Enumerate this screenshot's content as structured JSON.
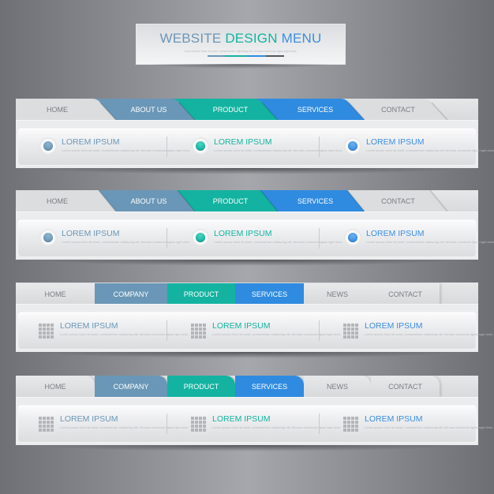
{
  "colors": {
    "steel_blue": "#6a97b7",
    "teal": "#14b3a1",
    "blue": "#2f8be0",
    "light_tab": "#dcdddf",
    "tab_text_light": "#7a7c80",
    "desc_text": "#b8babd"
  },
  "header": {
    "title_parts": [
      {
        "text": "WEBSITE ",
        "color": "#6a97b7"
      },
      {
        "text": "DESIGN ",
        "color": "#14b3a1"
      },
      {
        "text": "MENU",
        "color": "#3b8ee0"
      }
    ],
    "subtitle": "Lorem ipsum dolor sit amet, consectetuer adipiscing elit. Aenean commodo ligula eget dolor.",
    "underline_segments": [
      "#6a97b7",
      "#14b3a1",
      "#2f8be0",
      "#55575b"
    ]
  },
  "menus": [
    {
      "style": "curved-slant",
      "tabs": [
        "HOME",
        "ABOUT US",
        "PRODUCT",
        "SERVICES",
        "CONTACT"
      ],
      "icon": "circle-button-icon",
      "columns": [
        {
          "heading": "LOREM IPSUM",
          "color": "#6a97b7",
          "desc": "Lorem ipsum dolor sit amet, consectetuer adipiscing elit. Aenean commodo ligula eget dolor."
        },
        {
          "heading": "LOREM IPSUM",
          "color": "#14b3a1",
          "desc": "Lorem ipsum dolor sit amet, consectetuer adipiscing elit. Aenean commodo ligula eget dolor."
        },
        {
          "heading": "LOREM IPSUM",
          "color": "#3b8ee0",
          "desc": "Lorem ipsum dolor sit amet, consectetuer adipiscing elit. Aenean commodo ligula eget dolor."
        }
      ]
    },
    {
      "style": "straight-slant",
      "tabs": [
        "HOME",
        "ABOUT US",
        "PRODUCT",
        "SERVICES",
        "CONTACT"
      ],
      "icon": "circle-button-icon",
      "columns": [
        {
          "heading": "LOREM IPSUM",
          "color": "#6a97b7",
          "desc": "Lorem ipsum dolor sit amet, consectetuer adipiscing elit. Aenean commodo ligula eget dolor."
        },
        {
          "heading": "LOREM IPSUM",
          "color": "#14b3a1",
          "desc": "Lorem ipsum dolor sit amet, consectetuer adipiscing elit. Aenean commodo ligula eget dolor."
        },
        {
          "heading": "LOREM IPSUM",
          "color": "#3b8ee0",
          "desc": "Lorem ipsum dolor sit amet, consectetuer adipiscing elit. Aenean commodo ligula eget dolor."
        }
      ]
    },
    {
      "style": "rectangular",
      "tabs": [
        "HOME",
        "COMPANY",
        "PRODUCT",
        "SERVICES",
        "NEWS",
        "CONTACT"
      ],
      "icon": "grid-icon",
      "columns": [
        {
          "heading": "LOREM IPSUM",
          "color": "#6a97b7",
          "desc": "Lorem ipsum dolor sit amet, consectetuer adipiscing elit. Aenean commodo ligula eget dolor."
        },
        {
          "heading": "LOREM IPSUM",
          "color": "#14b3a1",
          "desc": "Lorem ipsum dolor sit amet, consectetuer adipiscing elit. Aenean commodo ligula eget dolor."
        },
        {
          "heading": "LOREM IPSUM",
          "color": "#3b8ee0",
          "desc": "Lorem ipsum dolor sit amet, consectetuer adipiscing elit. Aenean commodo ligula eget dolor."
        }
      ]
    },
    {
      "style": "rounded",
      "tabs": [
        "HOME",
        "COMPANY",
        "PRODUCT",
        "SERVICES",
        "NEWS",
        "CONTACT"
      ],
      "icon": "grid-icon",
      "columns": [
        {
          "heading": "LOREM IPSUM",
          "color": "#6a97b7",
          "desc": "Lorem ipsum dolor sit amet, consectetuer adipiscing elit. Aenean commodo ligula eget dolor."
        },
        {
          "heading": "LOREM IPSUM",
          "color": "#14b3a1",
          "desc": "Lorem ipsum dolor sit amet, consectetuer adipiscing elit. Aenean commodo ligula eget dolor."
        },
        {
          "heading": "LOREM IPSUM",
          "color": "#3b8ee0",
          "desc": "Lorem ipsum dolor sit amet, consectetuer adipiscing elit. Aenean commodo ligula eget dolor."
        }
      ]
    }
  ]
}
